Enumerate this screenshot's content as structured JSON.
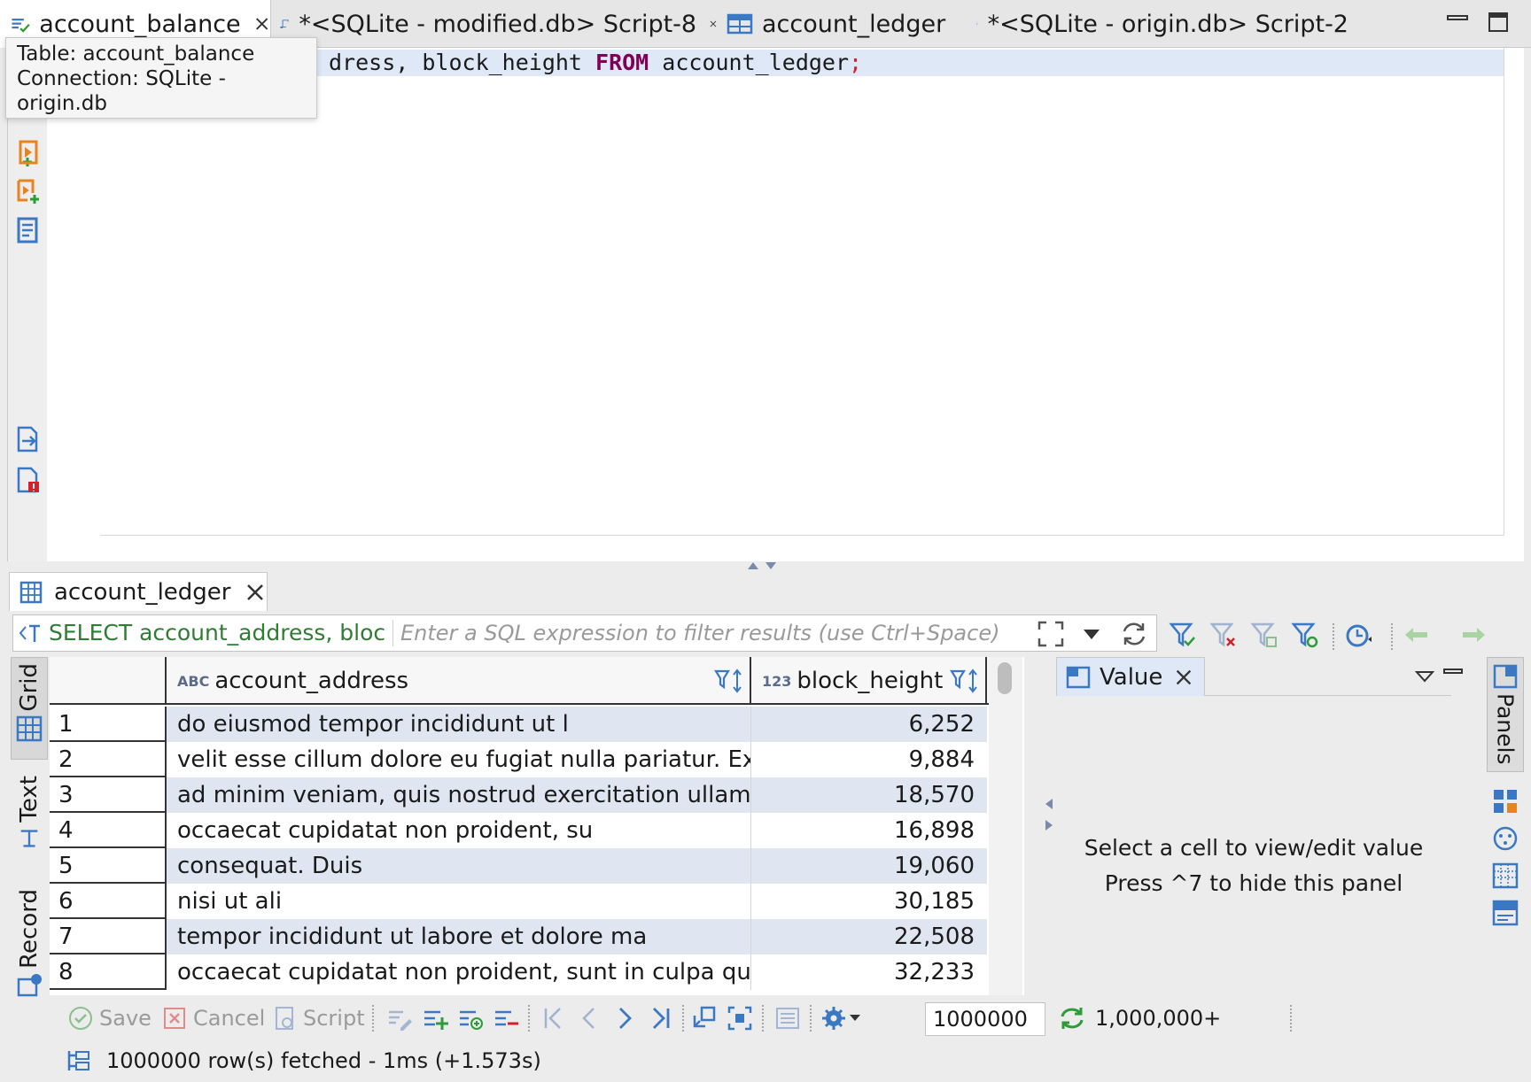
{
  "editor_tabs": [
    {
      "label": "account_balance",
      "icon": "table-edit-icon",
      "closable": true,
      "active": true
    },
    {
      "label": "*<SQLite - modified.db> Script-8",
      "icon": "script-icon",
      "closable": true,
      "active": false
    },
    {
      "label": "account_ledger",
      "icon": "table-icon",
      "closable": false,
      "active": false
    },
    {
      "label": "*<SQLite - origin.db> Script-2",
      "icon": "script-icon",
      "closable": false,
      "active": false
    }
  ],
  "tooltip": {
    "line1": "Table: account_balance",
    "line2": "Connection: SQLite - origin.db"
  },
  "editor": {
    "code_visible_part1": "dress, block_height ",
    "code_keyword": "FROM",
    "code_visible_part2": " account_ledger",
    "code_terminator": ";"
  },
  "results": {
    "tab_label": "account_ledger",
    "query_text": "SELECT account_address, bloc",
    "filter_placeholder": "Enter a SQL expression to filter results (use Ctrl+Space)",
    "side_tabs": [
      "Grid",
      "Text",
      "Record"
    ],
    "columns": [
      {
        "type_badge": "ABC",
        "name": "account_address"
      },
      {
        "type_badge": "123",
        "name": "block_height"
      }
    ],
    "rows": [
      {
        "num": "1",
        "address": "do eiusmod tempor incididunt ut l",
        "block_height": "6,252"
      },
      {
        "num": "2",
        "address": "velit esse cillum dolore eu fugiat nulla pariatur. Except",
        "block_height": "9,884"
      },
      {
        "num": "3",
        "address": "ad minim veniam, quis nostrud exercitation ullamco la",
        "block_height": "18,570"
      },
      {
        "num": "4",
        "address": "occaecat cupidatat non proident, su",
        "block_height": "16,898"
      },
      {
        "num": "5",
        "address": "consequat. Duis",
        "block_height": "19,060"
      },
      {
        "num": "6",
        "address": "nisi ut ali",
        "block_height": "30,185"
      },
      {
        "num": "7",
        "address": "tempor incididunt ut labore et dolore ma",
        "block_height": "22,508"
      },
      {
        "num": "8",
        "address": "occaecat cupidatat non proident, sunt in culpa qui off",
        "block_height": "32,233"
      }
    ],
    "value_panel": {
      "tab_label": "Value",
      "message_line1": "Select a cell to view/edit value",
      "message_line2": "Press ^7 to hide this panel"
    },
    "panels_label": "Panels",
    "toolbar": {
      "save": "Save",
      "cancel": "Cancel",
      "script": "Script",
      "fetch_size": "1000000",
      "row_count": "1,000,000+"
    },
    "status": "1000000 row(s) fetched - 1ms (+1.573s)"
  },
  "colors": {
    "accent_blue": "#3b78c4",
    "selected_row": "#dfe6f1",
    "query_green": "#2e7d32",
    "keyword": "#7f0055",
    "script_orange": "#e8841f"
  }
}
